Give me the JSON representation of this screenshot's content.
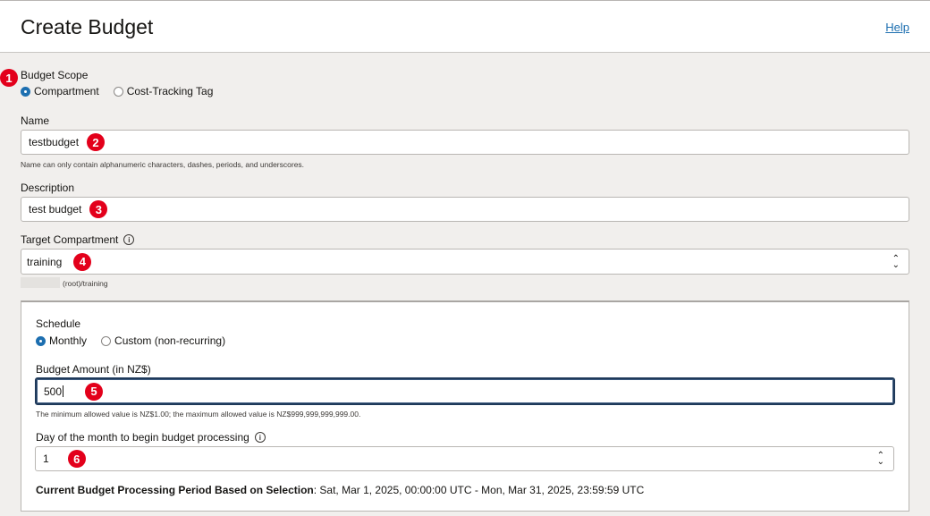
{
  "header": {
    "title": "Create Budget",
    "help_label": "Help"
  },
  "markers": [
    "1",
    "2",
    "3",
    "4",
    "5",
    "6"
  ],
  "budget_scope": {
    "label": "Budget Scope",
    "options": [
      "Compartment",
      "Cost-Tracking Tag"
    ],
    "selected": "Compartment"
  },
  "name": {
    "label": "Name",
    "value": "testbudget",
    "hint": "Name can only contain alphanumeric characters, dashes, periods, and underscores."
  },
  "description": {
    "label": "Description",
    "value": "test budget"
  },
  "target_compartment": {
    "label": "Target Compartment",
    "value": "training",
    "path": "(root)/training"
  },
  "schedule": {
    "label": "Schedule",
    "options": [
      "Monthly",
      "Custom (non-recurring)"
    ],
    "selected": "Monthly"
  },
  "budget_amount": {
    "label": "Budget Amount (in NZ$)",
    "value": "500",
    "hint": "The minimum allowed value is NZ$1.00; the maximum allowed value is NZ$999,999,999,999.00."
  },
  "day_of_month": {
    "label": "Day of the month to begin budget processing",
    "value": "1"
  },
  "period": {
    "label": "Current Budget Processing Period Based on Selection",
    "value": ": Sat, Mar 1, 2025, 00:00:00 UTC - Mon, Mar 31, 2025, 23:59:59 UTC"
  },
  "icons": {
    "info": "info-icon",
    "select": "chevron-up-down-icon",
    "radio": "radio-icon"
  },
  "colors": {
    "link": "#1d6fb0",
    "marker": "#e3001b",
    "page_bg": "#f1efed",
    "focus_border": "#1f3a5a"
  }
}
